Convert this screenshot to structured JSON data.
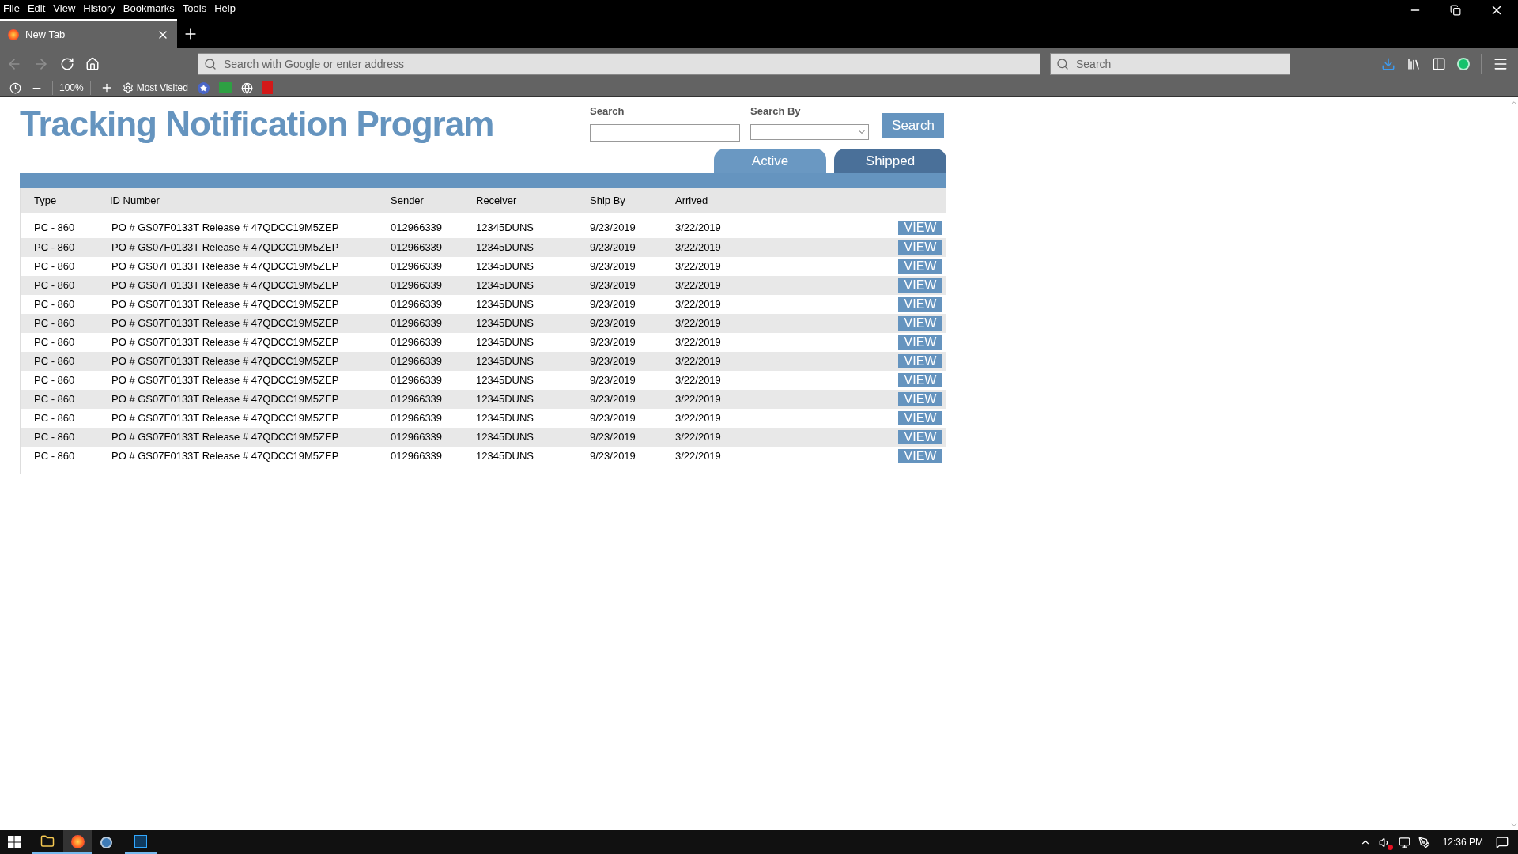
{
  "menu_bar": [
    "File",
    "Edit",
    "View",
    "History",
    "Bookmarks",
    "Tools",
    "Help"
  ],
  "tab": {
    "title": "New Tab",
    "selected": true
  },
  "address_bar": {
    "placeholder": "Search with Google or enter address"
  },
  "search_bar": {
    "placeholder": "Search"
  },
  "bookmarks_bar": {
    "zoom": "100%",
    "most_visited": "Most Visited"
  },
  "page": {
    "title": "Tracking Notification Program",
    "search": {
      "label": "Search"
    },
    "search_by": {
      "label": "Search By"
    },
    "search_button": "Search",
    "tabs": [
      {
        "label": "Active",
        "selected": true
      },
      {
        "label": "Shipped",
        "selected": false
      }
    ],
    "table": {
      "columns": [
        "Type",
        "ID Number",
        "Sender",
        "Receiver",
        "Ship By",
        "Arrived"
      ],
      "rows": [
        {
          "type": "PC - 860",
          "id_number": "PO # GS07F0133T Release # 47QDCC19M5ZEP",
          "sender": "012966339",
          "receiver": "12345DUNS",
          "ship_by": "9/23/2019",
          "arrived": "3/22/2019",
          "action": "VIEW"
        },
        {
          "type": "PC - 860",
          "id_number": "PO # GS07F0133T Release # 47QDCC19M5ZEP",
          "sender": "012966339",
          "receiver": "12345DUNS",
          "ship_by": "9/23/2019",
          "arrived": "3/22/2019",
          "action": "VIEW"
        },
        {
          "type": "PC - 860",
          "id_number": "PO # GS07F0133T Release # 47QDCC19M5ZEP",
          "sender": "012966339",
          "receiver": "12345DUNS",
          "ship_by": "9/23/2019",
          "arrived": "3/22/2019",
          "action": "VIEW"
        },
        {
          "type": "PC - 860",
          "id_number": "PO # GS07F0133T Release # 47QDCC19M5ZEP",
          "sender": "012966339",
          "receiver": "12345DUNS",
          "ship_by": "9/23/2019",
          "arrived": "3/22/2019",
          "action": "VIEW"
        },
        {
          "type": "PC - 860",
          "id_number": "PO # GS07F0133T Release # 47QDCC19M5ZEP",
          "sender": "012966339",
          "receiver": "12345DUNS",
          "ship_by": "9/23/2019",
          "arrived": "3/22/2019",
          "action": "VIEW"
        },
        {
          "type": "PC - 860",
          "id_number": "PO # GS07F0133T Release # 47QDCC19M5ZEP",
          "sender": "012966339",
          "receiver": "12345DUNS",
          "ship_by": "9/23/2019",
          "arrived": "3/22/2019",
          "action": "VIEW"
        },
        {
          "type": "PC - 860",
          "id_number": "PO # GS07F0133T Release # 47QDCC19M5ZEP",
          "sender": "012966339",
          "receiver": "12345DUNS",
          "ship_by": "9/23/2019",
          "arrived": "3/22/2019",
          "action": "VIEW"
        },
        {
          "type": "PC - 860",
          "id_number": "PO # GS07F0133T Release # 47QDCC19M5ZEP",
          "sender": "012966339",
          "receiver": "12345DUNS",
          "ship_by": "9/23/2019",
          "arrived": "3/22/2019",
          "action": "VIEW"
        },
        {
          "type": "PC - 860",
          "id_number": "PO # GS07F0133T Release # 47QDCC19M5ZEP",
          "sender": "012966339",
          "receiver": "12345DUNS",
          "ship_by": "9/23/2019",
          "arrived": "3/22/2019",
          "action": "VIEW"
        },
        {
          "type": "PC - 860",
          "id_number": "PO # GS07F0133T Release # 47QDCC19M5ZEP",
          "sender": "012966339",
          "receiver": "12345DUNS",
          "ship_by": "9/23/2019",
          "arrived": "3/22/2019",
          "action": "VIEW"
        },
        {
          "type": "PC - 860",
          "id_number": "PO # GS07F0133T Release # 47QDCC19M5ZEP",
          "sender": "012966339",
          "receiver": "12345DUNS",
          "ship_by": "9/23/2019",
          "arrived": "3/22/2019",
          "action": "VIEW"
        },
        {
          "type": "PC - 860",
          "id_number": "PO # GS07F0133T Release # 47QDCC19M5ZEP",
          "sender": "012966339",
          "receiver": "12345DUNS",
          "ship_by": "9/23/2019",
          "arrived": "3/22/2019",
          "action": "VIEW"
        },
        {
          "type": "PC - 860",
          "id_number": "PO # GS07F0133T Release # 47QDCC19M5ZEP",
          "sender": "012966339",
          "receiver": "12345DUNS",
          "ship_by": "9/23/2019",
          "arrived": "3/22/2019",
          "action": "VIEW"
        }
      ]
    }
  },
  "taskbar": {
    "clock": "12:36 PM"
  }
}
